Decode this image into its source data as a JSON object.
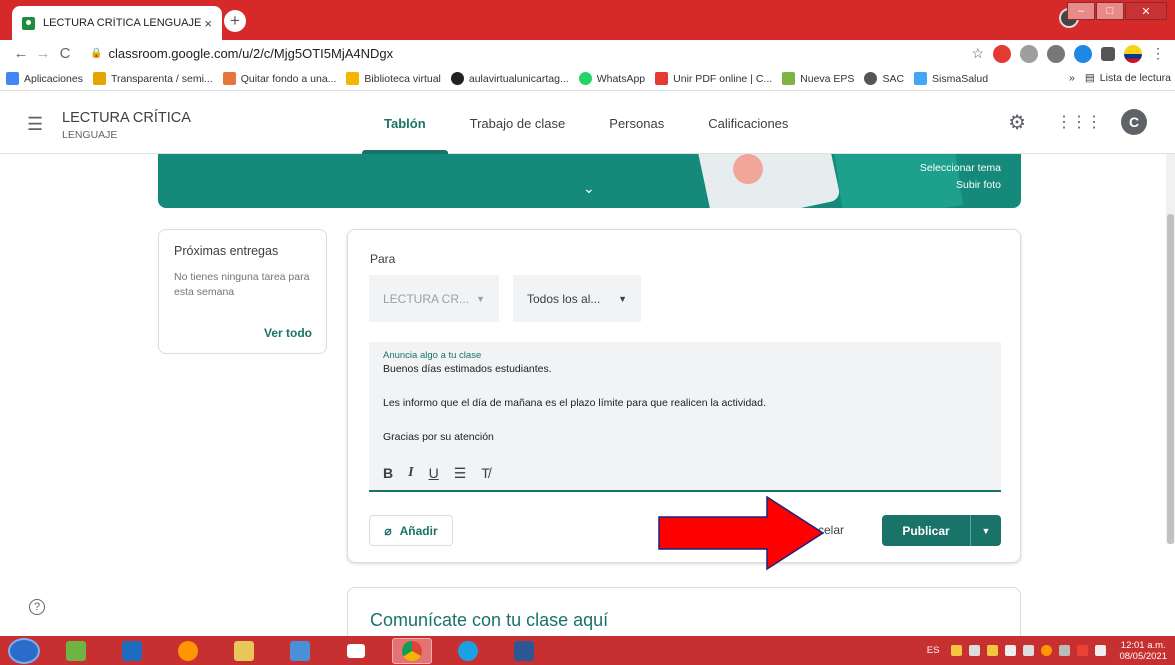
{
  "browser": {
    "tab_title": "LECTURA CRÍTICA LENGUAJE",
    "tab_close": "×",
    "new_tab": "+",
    "url": "classroom.google.com/u/2/c/Mjg5OTI5MjA4NDgx",
    "bookmarks": [
      {
        "label": "Aplicaciones",
        "color": "#4285f4"
      },
      {
        "label": "Transparenta / semi...",
        "color": "#e6a400"
      },
      {
        "label": "Quitar fondo a una...",
        "color": "#e8743b"
      },
      {
        "label": "Biblioteca virtual",
        "color": "#f4b400"
      },
      {
        "label": "aulavirtualunicartag...",
        "color": "#202124"
      },
      {
        "label": "WhatsApp",
        "color": "#25d366"
      },
      {
        "label": "Unir PDF online | C...",
        "color": "#e53935"
      },
      {
        "label": "Nueva EPS",
        "color": "#7cb342"
      },
      {
        "label": "SAC",
        "color": "#555555"
      },
      {
        "label": "SismaSalud",
        "color": "#42a5f5"
      }
    ],
    "bookmarks_overflow": "»",
    "reading_list": "Lista de lectura"
  },
  "header": {
    "course_title": "LECTURA CRÍTICA",
    "course_subtitle": "LENGUAJE",
    "tabs": [
      {
        "label": "Tablón",
        "active": true
      },
      {
        "label": "Trabajo de clase",
        "active": false
      },
      {
        "label": "Personas",
        "active": false
      },
      {
        "label": "Calificaciones",
        "active": false
      }
    ],
    "avatar_letter": "C"
  },
  "banner": {
    "select_theme": "Seleccionar tema",
    "upload_photo": "Subir foto"
  },
  "upcoming": {
    "title": "Próximas entregas",
    "empty_text": "No tienes ninguna tarea para esta semana",
    "view_all": "Ver todo"
  },
  "composer": {
    "for_label": "Para",
    "class_select": "LECTURA CR...",
    "students_select": "Todos los al...",
    "editor_label": "Anuncia algo a tu clase",
    "lines": [
      "Buenos días estimados estudiantes.",
      "",
      "Les informo que el día de mañana es el plazo límite para que realicen la actividad.",
      "",
      "Gracias por su atención"
    ],
    "add_label": "Añadir",
    "cancel_label": "celar",
    "publish_label": "Publicar"
  },
  "stream": {
    "communicate": "Comunícate con tu clase aquí"
  },
  "taskbar": {
    "lang": "ES",
    "time": "12:01 a.m.",
    "date": "08/05/2021"
  },
  "colors": {
    "accent": "#1a7368",
    "banner": "#158a7a",
    "browser_chrome": "#d62a2a",
    "arrow": "#ff0000"
  }
}
